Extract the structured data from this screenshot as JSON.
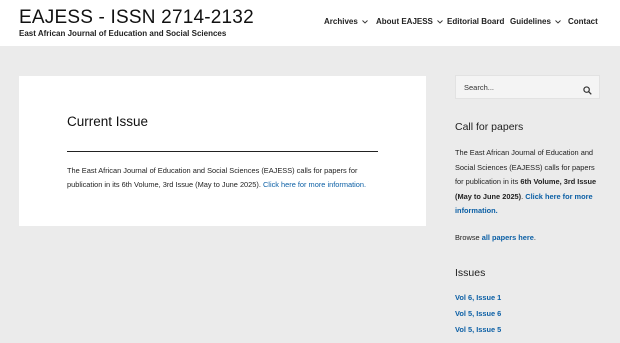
{
  "header": {
    "title": "EAJESS - ISSN 2714-2132",
    "tagline": "East African Journal of Education and Social Sciences"
  },
  "nav": {
    "archives": "Archives",
    "about": "About EAJESS",
    "editorial": "Editorial Board",
    "guidelines": "Guidelines",
    "contact": "Contact"
  },
  "main": {
    "title": "Current Issue",
    "text": "The East African Journal of Education and Social Sciences (EAJESS) calls for papers for publication in its 6th Volume, 3rd Issue (May to June 2025). ",
    "link": "Click here for more information."
  },
  "sidebar": {
    "search_placeholder": "Search...",
    "call_heading": "Call for papers",
    "call_text_1": "The East African Journal of Education and Social Sciences (EAJESS) calls for papers for publication in its ",
    "call_bold_1": "6th Volume, 3rd Issue (May to June 2025)",
    "call_text_2": ". ",
    "call_link": "Click here for more information.",
    "browse_prefix": "Browse ",
    "browse_link": "all papers here",
    "browse_suffix": ".",
    "issues_heading": "Issues",
    "issues": [
      "Vol 6, Issue 1",
      "Vol 5, Issue 6",
      "Vol 5, Issue 5"
    ]
  },
  "colors": {
    "link": "#0b5fa5",
    "background": "#ebebeb",
    "card": "#ffffff"
  }
}
